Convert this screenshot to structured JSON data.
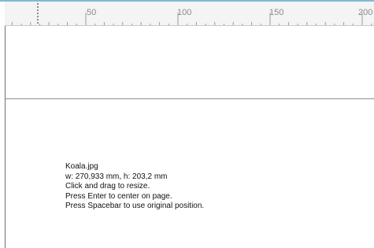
{
  "ruler": {
    "labels": [
      "50",
      "100",
      "150",
      "200"
    ]
  },
  "placed_image": {
    "filename": "Koala.jpg",
    "dimensions": "w: 270,933 mm, h: 203,2 mm",
    "hint_resize": "Click and drag to resize.",
    "hint_center": "Press Enter to center on page.",
    "hint_original": "Press Spacebar to use original position."
  }
}
